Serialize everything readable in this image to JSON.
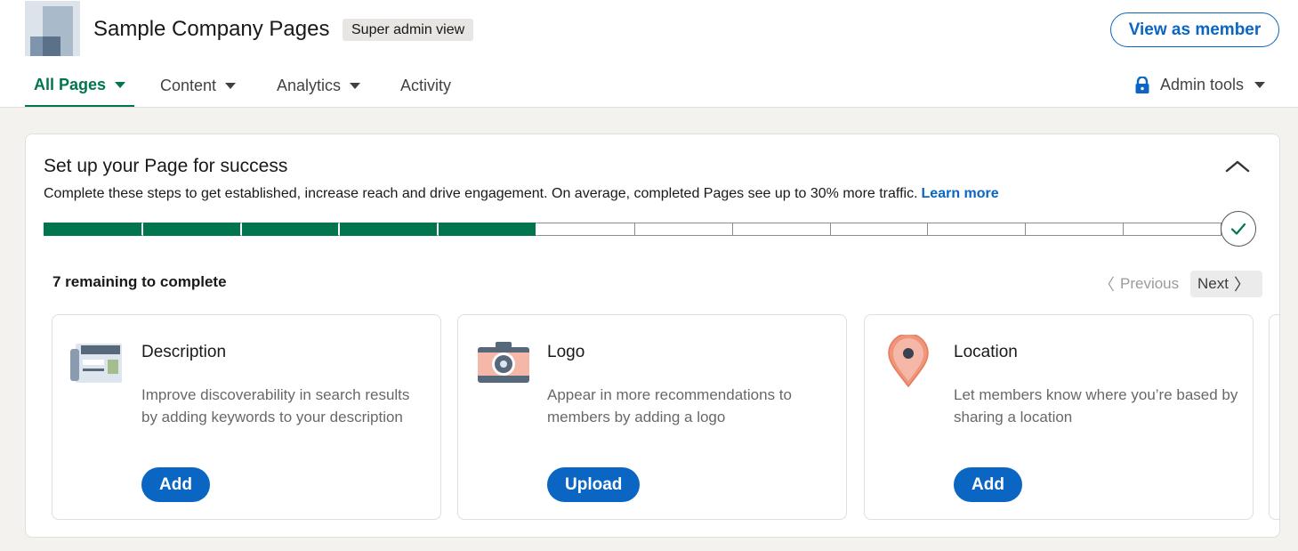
{
  "header": {
    "company_name": "Sample Company Pages",
    "badge": "Super admin view",
    "view_member_label": "View as member"
  },
  "nav": {
    "tabs": [
      {
        "label": "All Pages",
        "active": true,
        "dropdown": true
      },
      {
        "label": "Content",
        "active": false,
        "dropdown": true
      },
      {
        "label": "Analytics",
        "active": false,
        "dropdown": true
      },
      {
        "label": "Activity",
        "active": false,
        "dropdown": false
      }
    ],
    "admin_tools_label": "Admin tools"
  },
  "setup": {
    "title": "Set up your Page for success",
    "description": "Complete these steps to get established, increase reach and drive engagement. On average, completed Pages see up to 30% more traffic.",
    "learn_more": "Learn more",
    "progress": {
      "completed_steps": 5,
      "total_steps": 12
    },
    "remaining_text": "7 remaining to complete",
    "previous_label": "Previous",
    "next_label": "Next",
    "steps": [
      {
        "title": "Description",
        "text": "Improve discoverability in search results by adding keywords to your description",
        "button": "Add",
        "icon": "newspaper-icon"
      },
      {
        "title": "Logo",
        "text": "Appear in more recommendations to members by adding a logo",
        "button": "Upload",
        "icon": "camera-icon"
      },
      {
        "title": "Location",
        "text": "Let members know where you’re based by sharing a location",
        "button": "Add",
        "icon": "map-pin-icon"
      }
    ]
  },
  "colors": {
    "brand_blue": "#0a66c2",
    "progress_green": "#01754f",
    "page_bg": "#f4f2ee"
  }
}
